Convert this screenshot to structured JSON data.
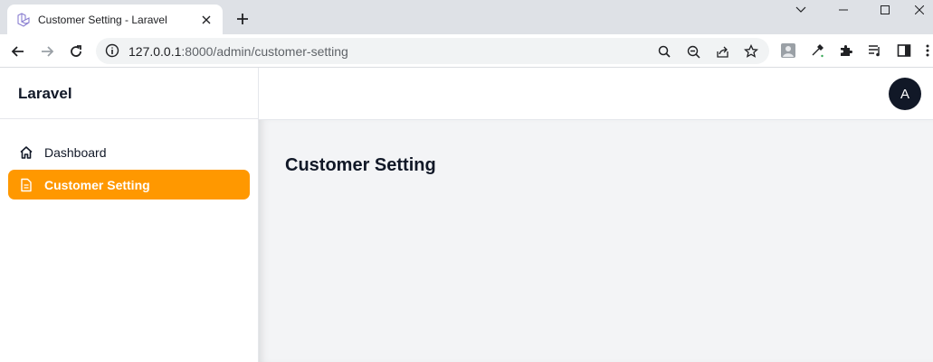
{
  "browser": {
    "tab_title": "Customer Setting - Laravel",
    "url_host": "127.0.0.1",
    "url_path": ":8000/admin/customer-setting"
  },
  "app": {
    "brand": "Laravel",
    "avatar_initial": "A",
    "accent_color": "#ff9800",
    "nav": [
      {
        "label": "Dashboard",
        "icon": "home-icon",
        "active": false
      },
      {
        "label": "Customer Setting",
        "icon": "document-icon",
        "active": true
      }
    ],
    "page_title": "Customer Setting"
  }
}
